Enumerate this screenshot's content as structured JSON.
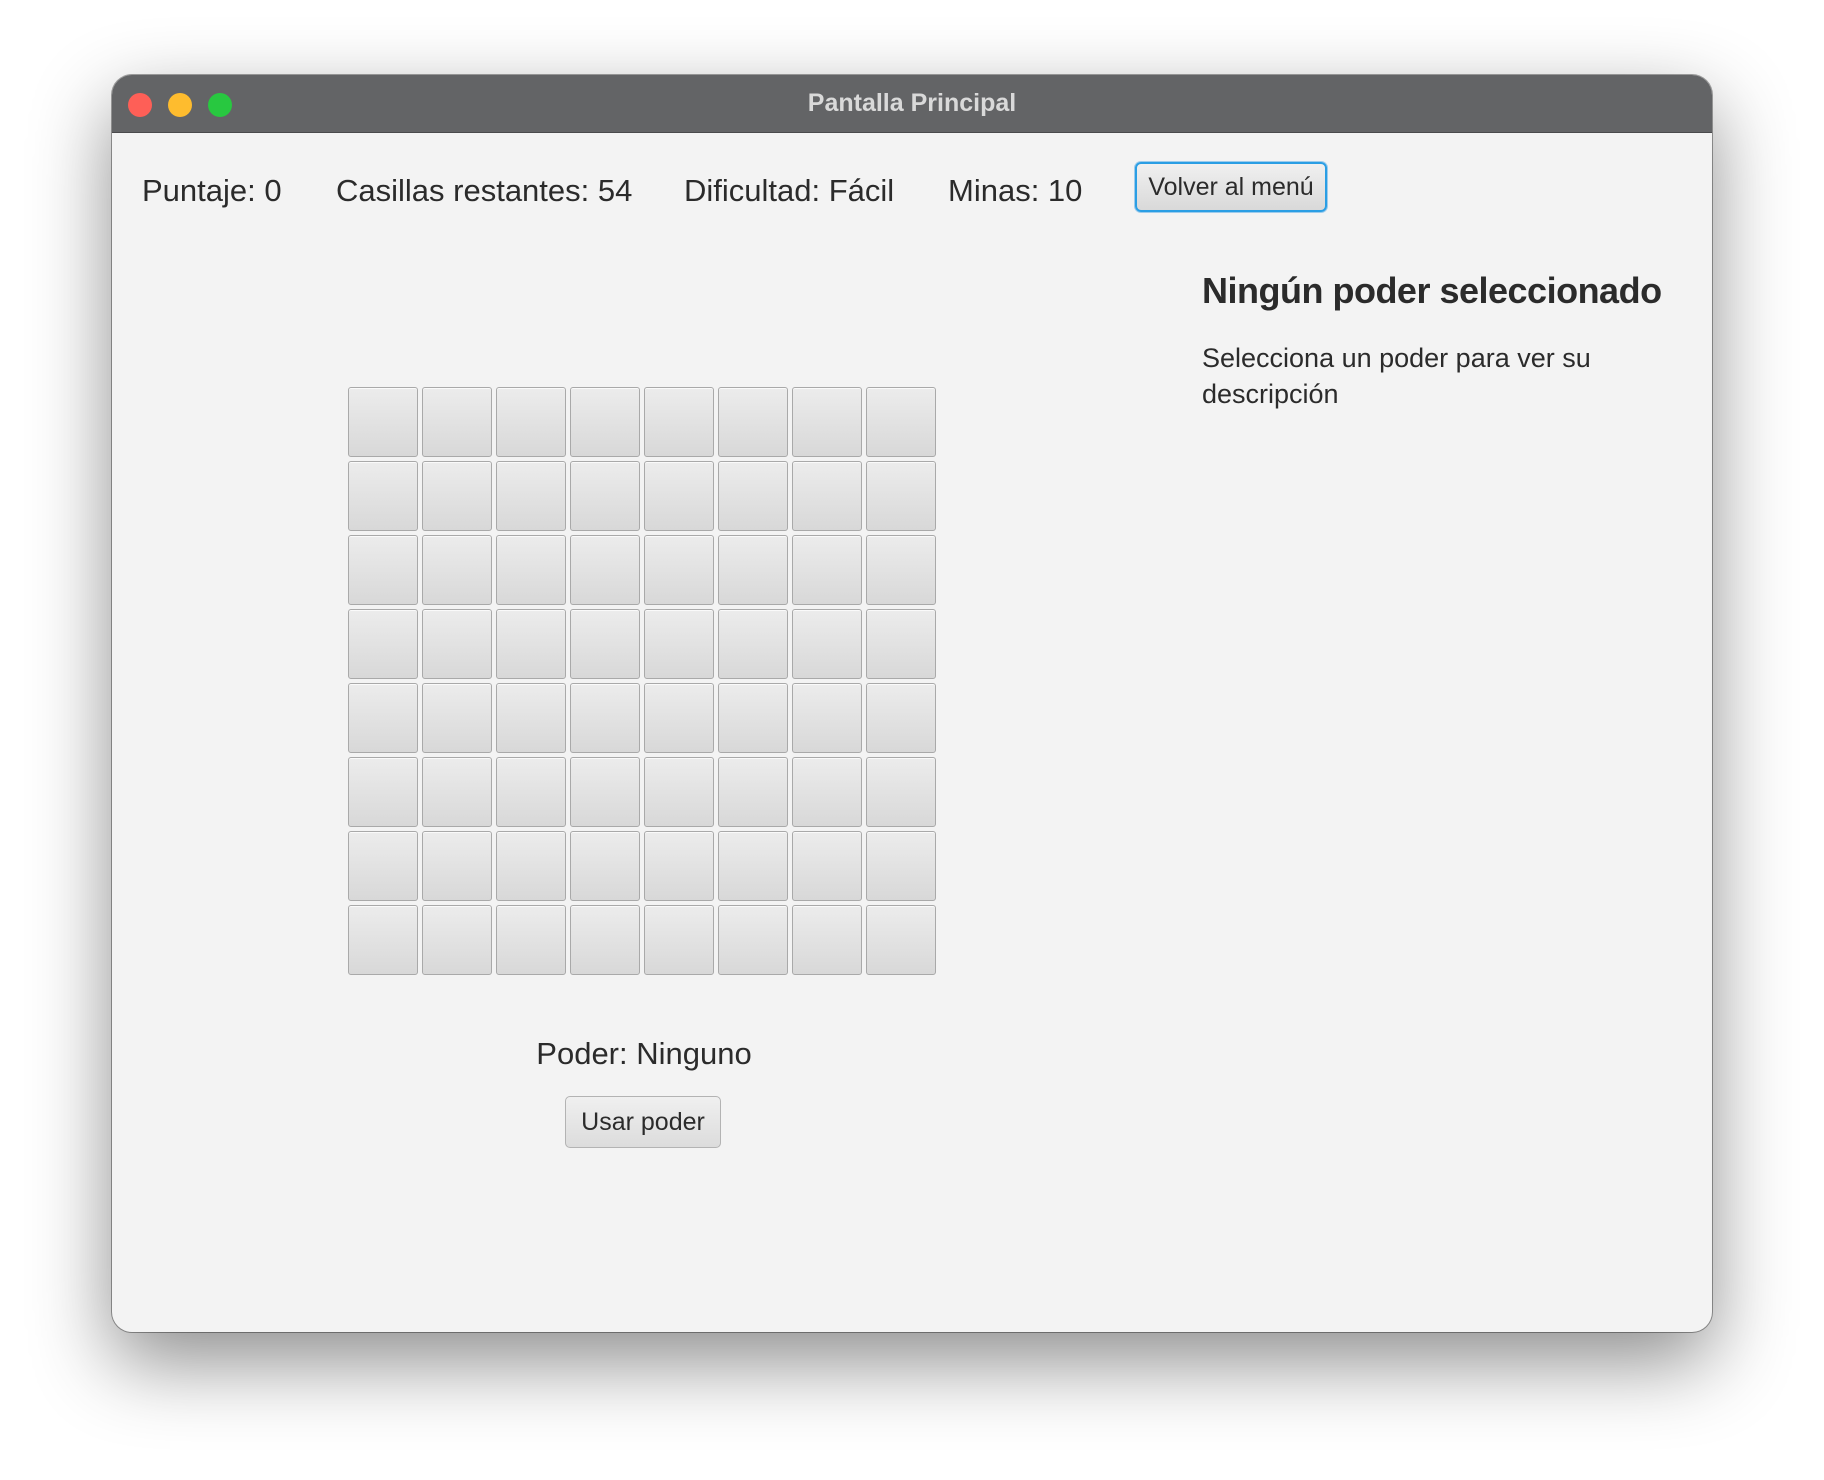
{
  "window": {
    "title": "Pantalla Principal"
  },
  "status": {
    "score": "Puntaje: 0",
    "remaining": "Casillas restantes: 54",
    "difficulty": "Dificultad: Fácil",
    "mines": "Minas: 10",
    "menu_button": "Volver al menú"
  },
  "power_panel": {
    "title": "Ningún poder seleccionado",
    "description": "Selecciona un poder para ver su descripción"
  },
  "board": {
    "rows": 8,
    "cols": 8
  },
  "power": {
    "label": "Poder: Ninguno",
    "use_button": "Usar poder"
  }
}
